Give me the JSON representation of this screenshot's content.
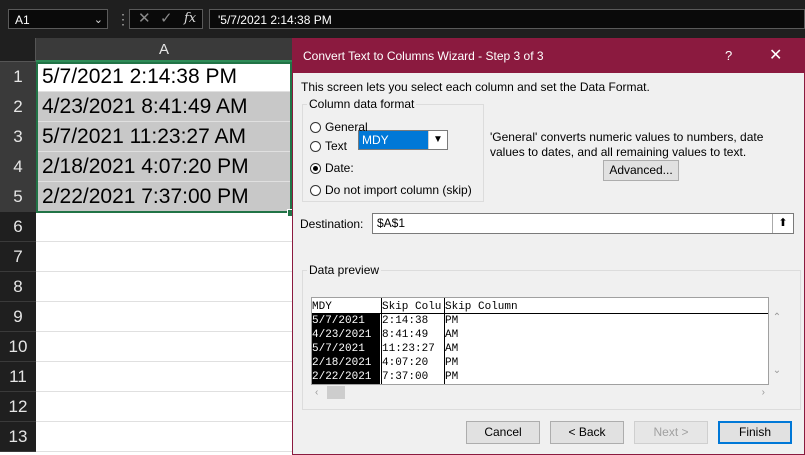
{
  "formula_bar": {
    "name_box": "A1",
    "fx": "fx",
    "formula": "'5/7/2021 2:14:38 PM"
  },
  "sheet": {
    "column_header": "A",
    "rows": [
      "1",
      "2",
      "3",
      "4",
      "5",
      "6",
      "7",
      "8",
      "9",
      "10",
      "11",
      "12",
      "13"
    ],
    "cells": [
      "5/7/2021 2:14:38 PM",
      "4/23/2021 8:41:49 AM",
      "5/7/2021 11:23:27 AM",
      "2/18/2021 4:07:20 PM",
      "2/22/2021 7:37:00 PM"
    ]
  },
  "dialog": {
    "title": "Convert Text to Columns Wizard - Step 3 of 3",
    "help": "?",
    "close": "✕",
    "intro": "This screen lets you select each column and set the Data Format.",
    "format_group": {
      "legend": "Column data format",
      "options": [
        "General",
        "Text",
        "Date:",
        "Do not import column (skip)"
      ],
      "selected": "Date:",
      "date_value": "MDY"
    },
    "general_desc": "'General' converts numeric values to numbers, date values to dates, and all remaining values to text.",
    "advanced": "Advanced...",
    "destination": {
      "label": "Destination:",
      "value": "$A$1"
    },
    "preview": {
      "legend": "Data preview",
      "headers": [
        "MDY",
        "Skip Colu",
        "Skip Column"
      ],
      "columns": [
        [
          "5/7/2021",
          "4/23/2021",
          "5/7/2021",
          "2/18/2021",
          "2/22/2021"
        ],
        [
          "2:14:38",
          "8:41:49",
          "11:23:27",
          "4:07:20",
          "7:37:00"
        ],
        [
          "PM",
          "AM",
          "AM",
          "PM",
          "PM"
        ]
      ]
    },
    "buttons": {
      "cancel": "Cancel",
      "back": "< Back",
      "next": "Next >",
      "finish": "Finish"
    }
  }
}
